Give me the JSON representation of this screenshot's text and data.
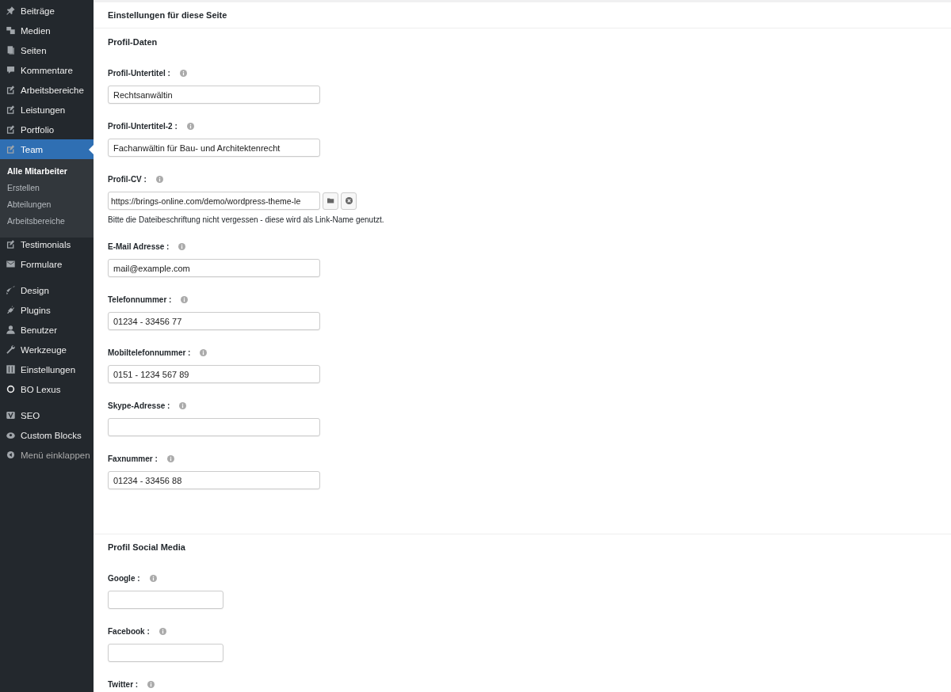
{
  "sidebar": {
    "groups": [
      {
        "items": [
          {
            "label": "Beiträge",
            "selected": false
          },
          {
            "label": "Medien",
            "selected": false
          },
          {
            "label": "Seiten",
            "selected": false
          },
          {
            "label": "Kommentare",
            "selected": false
          },
          {
            "label": "Arbeitsbereiche",
            "selected": false
          },
          {
            "label": "Leistungen",
            "selected": false
          },
          {
            "label": "Portfolio",
            "selected": false
          },
          {
            "label": "Team",
            "selected": true,
            "children": [
              {
                "label": "Alle Mitarbeiter",
                "selected": true
              },
              {
                "label": "Erstellen",
                "selected": false
              },
              {
                "label": "Abteilungen",
                "selected": false
              },
              {
                "label": "Arbeitsbereiche",
                "selected": false
              }
            ]
          },
          {
            "label": "Testimonials",
            "selected": false
          },
          {
            "label": "Formulare",
            "selected": false
          }
        ]
      },
      {
        "items": [
          {
            "label": "Design",
            "selected": false
          },
          {
            "label": "Plugins",
            "selected": false
          },
          {
            "label": "Benutzer",
            "selected": false
          },
          {
            "label": "Werkzeuge",
            "selected": false
          },
          {
            "label": "Einstellungen",
            "selected": false
          },
          {
            "label": "BO Lexus",
            "selected": false
          }
        ]
      },
      {
        "items": [
          {
            "label": "SEO",
            "selected": false
          },
          {
            "label": "Custom Blocks",
            "selected": false
          },
          {
            "label": "Menü einklappen",
            "selected": false,
            "kind": "collapse"
          }
        ]
      }
    ]
  },
  "panel": {
    "title": "Einstellungen für diese Seite",
    "sections": [
      {
        "title": "Profil-Daten",
        "fields": [
          {
            "kind": "text",
            "label": "Profil-Untertitel :",
            "value": "Rechtsanwältin"
          },
          {
            "kind": "text",
            "label": "Profil-Untertitel-2 :",
            "value": "Fachanwältin für Bau- und Architektenrecht"
          },
          {
            "kind": "file",
            "label": "Profil-CV :",
            "value": "https://brings-online.com/demo/wordpress-theme-le",
            "note": "Bitte die Dateibeschriftung nicht vergessen - diese wird als Link-Name genutzt."
          },
          {
            "kind": "text",
            "label": "E-Mail Adresse :",
            "value": "mail@example.com"
          },
          {
            "kind": "text",
            "label": "Telefonnummer :",
            "value": "01234 - 33456 77"
          },
          {
            "kind": "text",
            "label": "Mobiltelefonnummer :",
            "value": "0151 - 1234 567 89"
          },
          {
            "kind": "text",
            "label": "Skype-Adresse :"
          },
          {
            "kind": "text",
            "label": "Faxnummer :",
            "value": "01234 - 33456 88"
          }
        ]
      },
      {
        "title": "Profil Social Media",
        "fields": [
          {
            "kind": "short",
            "label": "Google :"
          },
          {
            "kind": "short",
            "label": "Facebook :"
          },
          {
            "kind": "label",
            "label": "Twitter :"
          }
        ]
      }
    ]
  }
}
